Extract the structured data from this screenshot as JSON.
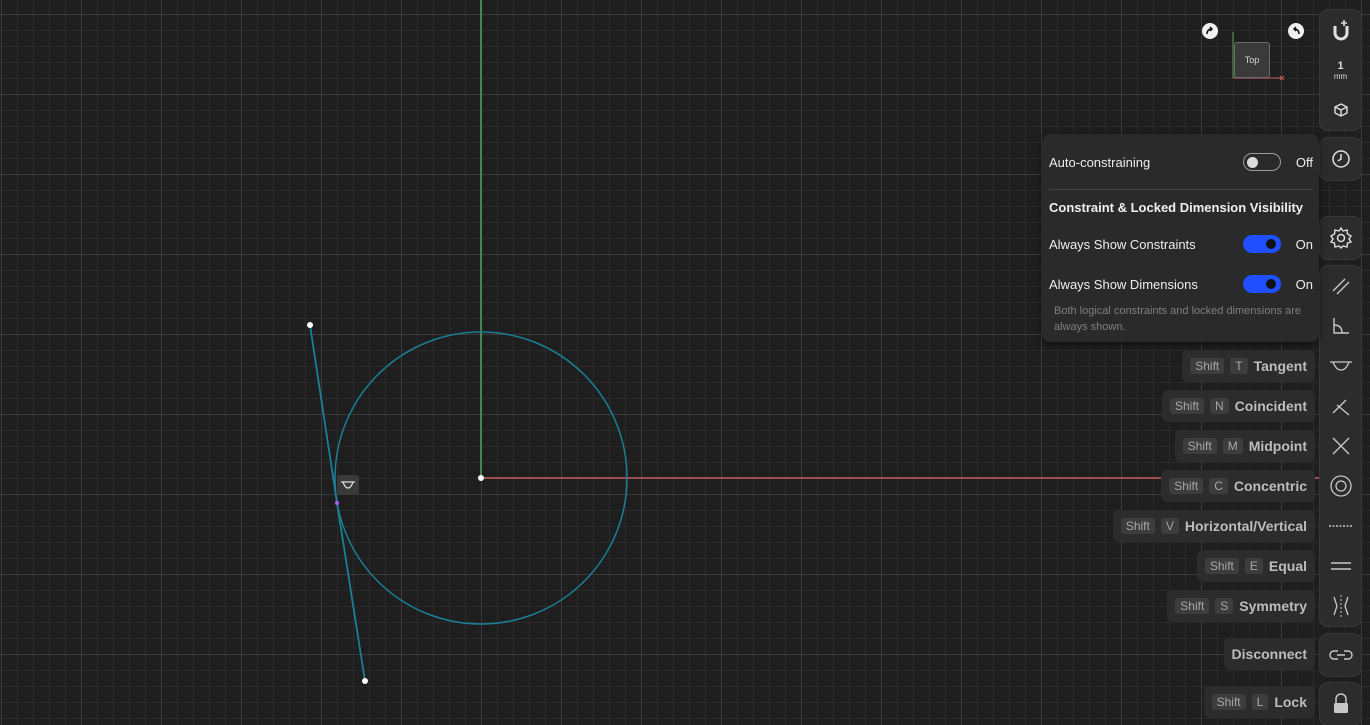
{
  "viewcube": {
    "face_label": "Top"
  },
  "right_toolbar": {
    "grid_unit_value": "1",
    "grid_unit_suffix": "mm"
  },
  "settings_popup": {
    "auto_constraining_label": "Auto-constraining",
    "auto_constraining_state": "Off",
    "visibility_title": "Constraint & Locked Dimension Visibility",
    "always_show_constraints_label": "Always Show Constraints",
    "always_show_constraints_state": "On",
    "always_show_dimensions_label": "Always Show Dimensions",
    "always_show_dimensions_state": "On",
    "note": "Both logical constraints and locked dimensions are always shown."
  },
  "shortcut_hints": [
    {
      "mod": "Shift",
      "key": "T",
      "label": "Tangent"
    },
    {
      "mod": "Shift",
      "key": "N",
      "label": "Coincident"
    },
    {
      "mod": "Shift",
      "key": "M",
      "label": "Midpoint"
    },
    {
      "mod": "Shift",
      "key": "C",
      "label": "Concentric"
    },
    {
      "mod": "Shift",
      "key": "V",
      "label": "Horizontal/Vertical"
    },
    {
      "mod": "Shift",
      "key": "E",
      "label": "Equal"
    },
    {
      "mod": "Shift",
      "key": "S",
      "label": "Symmetry"
    },
    {
      "label": "Disconnect"
    },
    {
      "mod": "Shift",
      "key": "L",
      "label": "Lock"
    }
  ],
  "colors": {
    "accent_toggle": "#1f4fff",
    "x_axis": "#c85a5a",
    "y_axis": "#57a05a",
    "sketch_geometry": "#1a7f96"
  },
  "icons": [
    "magnet-icon",
    "grid-unit",
    "view-cube-icon",
    "history-icon",
    "gear-icon",
    "parallel-icon",
    "perpendicular-icon",
    "tangent-icon",
    "coincident-icon",
    "midpoint-icon",
    "concentric-icon",
    "horizontal-vertical-icon",
    "equal-icon",
    "symmetry-icon",
    "disconnect-icon",
    "lock-icon"
  ]
}
